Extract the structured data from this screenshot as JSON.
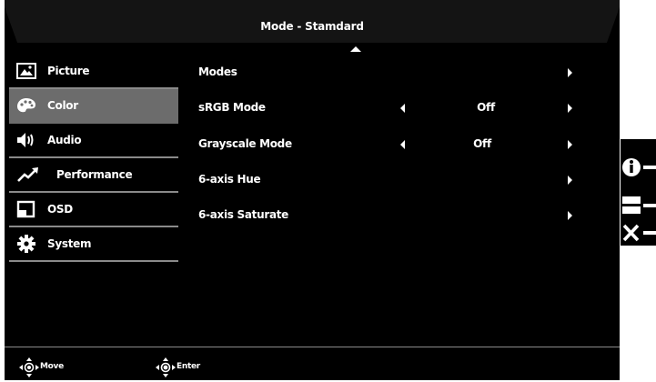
{
  "osd": {
    "title": "Mode - Stamdard"
  },
  "sidebar": {
    "items": [
      {
        "label": "Picture",
        "icon": "picture-icon"
      },
      {
        "label": "Color",
        "icon": "palette-icon",
        "active": true
      },
      {
        "label": "Audio",
        "icon": "speaker-icon"
      },
      {
        "label": "Performance",
        "icon": "trend-icon"
      },
      {
        "label": "OSD",
        "icon": "osd-window-icon"
      },
      {
        "label": "System",
        "icon": "gear-icon"
      }
    ]
  },
  "settings": {
    "rows": [
      {
        "label": "Modes",
        "value": ""
      },
      {
        "label": "sRGB Mode",
        "value": "Off"
      },
      {
        "label": "Grayscale Mode",
        "value": "Off"
      },
      {
        "label": "6-axis Hue",
        "value": ""
      },
      {
        "label": "6-axis Saturate",
        "value": ""
      }
    ]
  },
  "footer": {
    "move_label": "Move",
    "enter_label": "Enter"
  },
  "side_keys": [
    "info-key-icon",
    "menu-key-icon",
    "close-key-icon"
  ],
  "colors": {
    "background": "#000000",
    "selected": "#6c6c6c",
    "divider": "#8a8a8a",
    "text": "#ffffff"
  }
}
